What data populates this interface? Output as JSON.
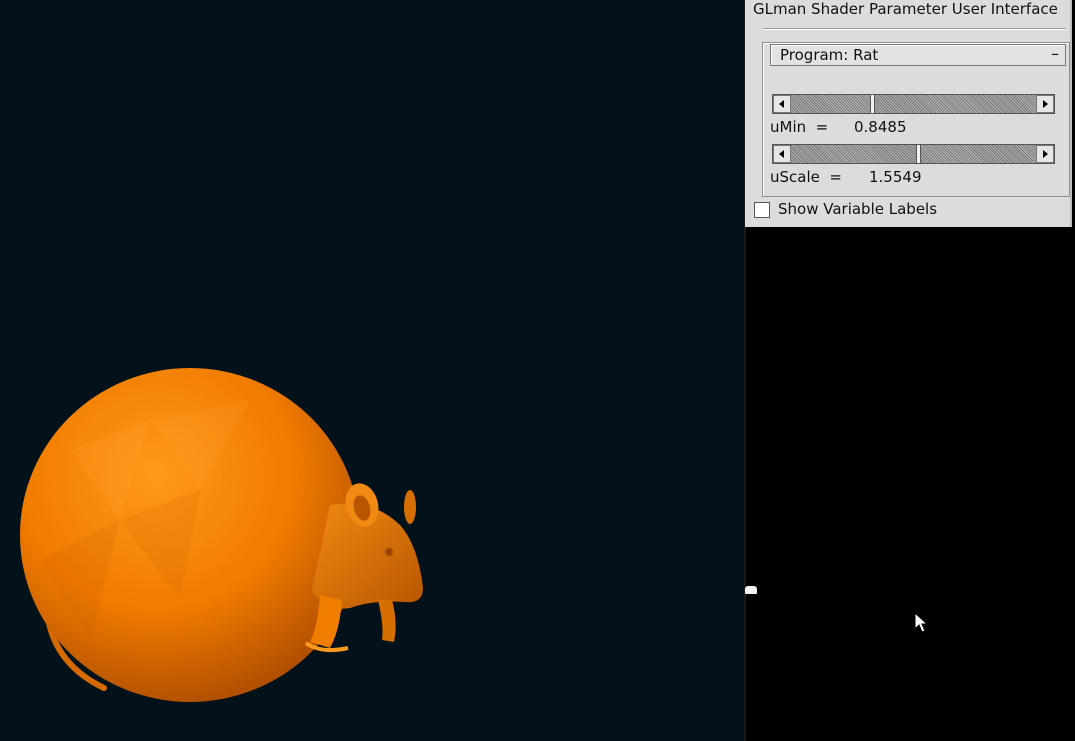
{
  "panel": {
    "title": "GLman Shader Parameter User Interface",
    "program_label": "Program: Rat",
    "rollout_toggle": "–",
    "params": [
      {
        "name": "uMin",
        "label": "uMin  =",
        "value": "0.8485",
        "fraction": 0.33
      },
      {
        "name": "uScale",
        "label": "uScale  =",
        "value": "1.5549",
        "fraction": 0.52
      }
    ],
    "checkbox_label": "Show Variable Labels",
    "checkbox_checked": false
  },
  "viewport": {
    "model": "rat",
    "model_color": "#ff7a00",
    "background": "#03121a"
  },
  "icons": [
    "arrow-left-icon",
    "arrow-right-icon",
    "mouse-cursor-icon"
  ]
}
